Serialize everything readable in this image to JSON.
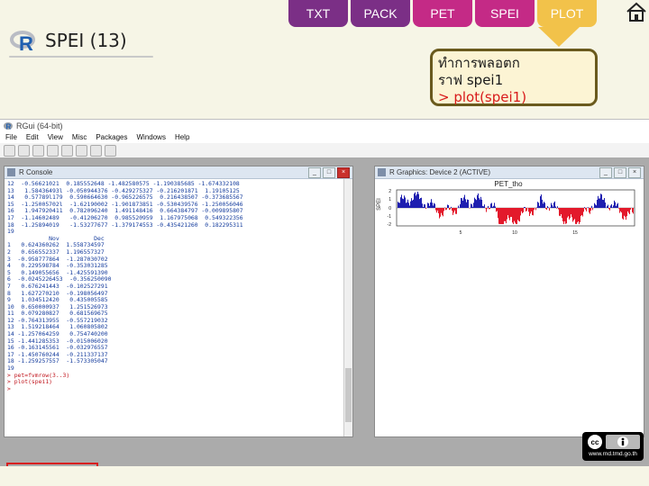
{
  "nav": {
    "tabs": [
      {
        "label": "TXT"
      },
      {
        "label": "PACK"
      },
      {
        "label": "PET"
      },
      {
        "label": "SPEI"
      },
      {
        "label": "PLOT"
      }
    ],
    "active": "PLOT"
  },
  "slide": {
    "title": "SPEI (13)",
    "callout_line1": "ทำการพลอตก",
    "callout_line2": "ราฟ spei1",
    "callout_cmd": "> plot(spei1)"
  },
  "app": {
    "title": "RGui (64-bit)",
    "menu": [
      "File",
      "Edit",
      "View",
      "Misc",
      "Packages",
      "Windows",
      "Help"
    ]
  },
  "console": {
    "title": "R Console",
    "lines": [
      "12  -0.56621021  0.185552648 -1.482580575 -1.190385685 -1.674332108",
      "13   1.58436493l -0.050944376 -0.429275327 -0.216201871  1.19105125",
      "14   0.57789l179  0.590664630 -0.965226575  0.216438507 -0.373685567",
      "15  -1.25005702l  -1.62190002 -1.901873851 -0.530439576 -1.250056046",
      "16   1.947920411  0.782096240  1.491148416  0.664384797 -0.009895807",
      "17  -1.14602489   -0.41206270  0.985520959  1.167975068  0.549322356",
      "18  -1.25894019   -1.53277677 -1.379174553 -0.435421260  0.182295311",
      "19",
      "            Nov          Dec",
      "1   0.624360262  1.558734597",
      "2   0.656552337  1.196557327",
      "3  -0.958777864  -1.287030702",
      "4   0.229598784  -0.353031285",
      "5   0.149055656  -1.425591390",
      "6  -0.0245226453  -0.356250090",
      "7   0.676241443  -0.102527291",
      "8   1.627270210  -0.198056497",
      "9   1.034512420   0.435005585",
      "10  0.650000937   1.251526973",
      "11  0.079280827   0.681569675",
      "12 -0.764313955  -0.557219032",
      "13  1.519218464   1.060805802",
      "14 -1.257064259   0.754740200",
      "15 -1.441285353  -0.015006020",
      "16 -0.163145561  -0.032976557",
      "17 -1.450760244  -0.211337137",
      "18 -1.259257557  -1.573305047",
      "19"
    ],
    "cmd1": "> pet=fvmrow(3..3)",
    "cmd2": "> plot(spei1)",
    "prompt": ">"
  },
  "graphics": {
    "title": "R Graphics: Device 2 (ACTIVE)",
    "plot_title": "PET_tho",
    "ylabel": "SPEI",
    "yticks": [
      "2",
      "1",
      "0",
      "-1",
      "-2"
    ],
    "xticks": [
      "5",
      "10",
      "15"
    ]
  },
  "license": {
    "site": "www.rnd.tmd.go.th"
  },
  "colors": {
    "tab_purple": "#7b2f86",
    "tab_pink": "#c42a86",
    "tab_active": "#f2c24a",
    "callout_border": "#6a5a1d",
    "callout_cmd": "#d81b1b",
    "positive_bars": "#1f1fb0",
    "negative_bars": "#e3192b",
    "highlight": "#d71f1f"
  }
}
